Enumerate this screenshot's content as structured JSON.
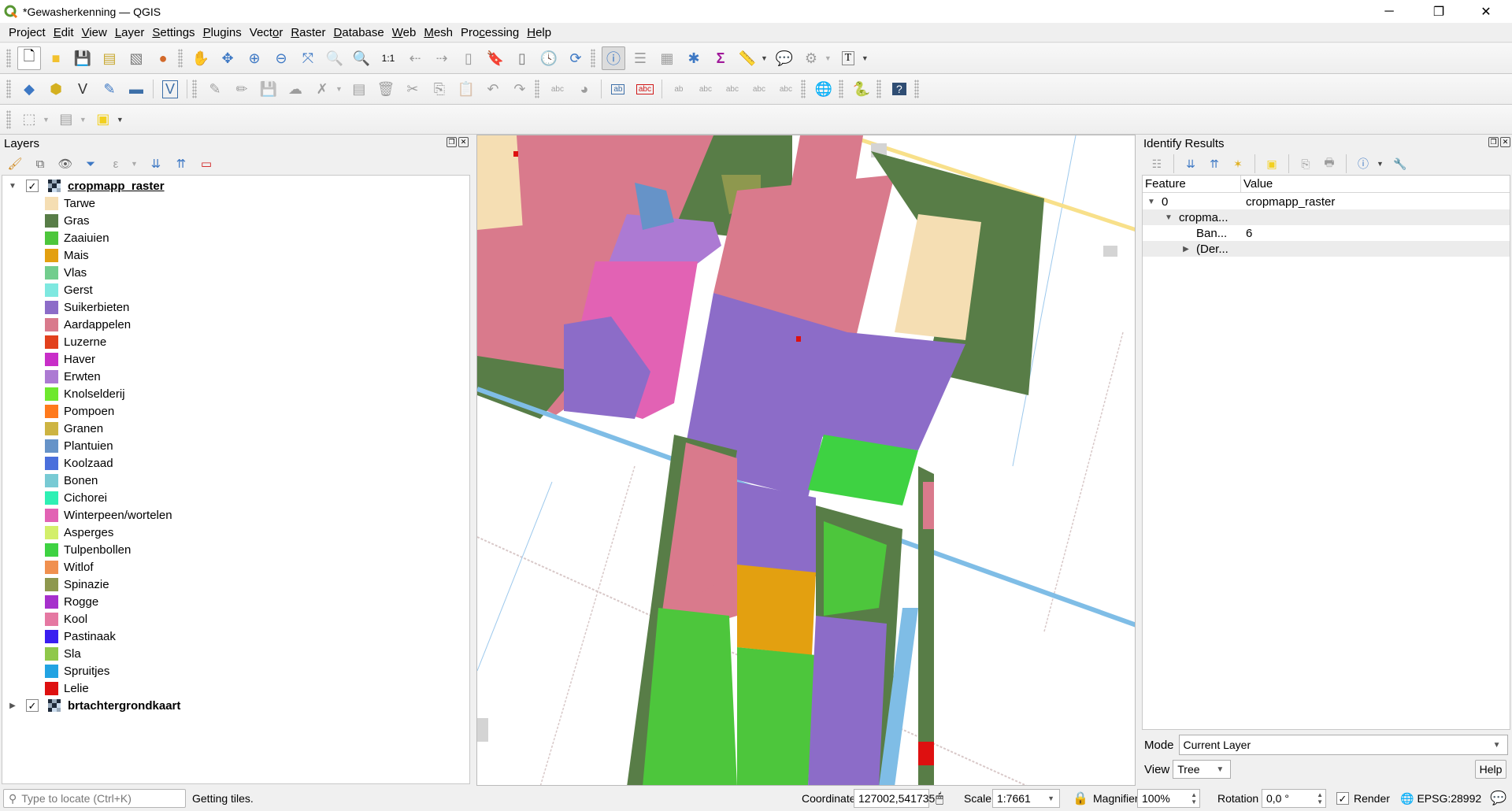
{
  "window": {
    "title": "*Gewasherkenning — QGIS",
    "app_icon": "qgis-logo-icon",
    "controls": {
      "minimize": "─",
      "maximize": "❐",
      "close": "✕"
    }
  },
  "menu": [
    {
      "label": "Project",
      "accel": "j"
    },
    {
      "label": "Edit",
      "accel": "E"
    },
    {
      "label": "View",
      "accel": "V"
    },
    {
      "label": "Layer",
      "accel": "L"
    },
    {
      "label": "Settings",
      "accel": "S"
    },
    {
      "label": "Plugins",
      "accel": "P"
    },
    {
      "label": "Vector",
      "accel": "o"
    },
    {
      "label": "Raster",
      "accel": "R"
    },
    {
      "label": "Database",
      "accel": "D"
    },
    {
      "label": "Web",
      "accel": "W"
    },
    {
      "label": "Mesh",
      "accel": "M"
    },
    {
      "label": "Processing",
      "accel": "c"
    },
    {
      "label": "Help",
      "accel": "H"
    }
  ],
  "toolbar1": {
    "icons": [
      "new-project-icon",
      "open-project-icon",
      "save-project-icon",
      "new-print-layout-icon",
      "layout-manager-icon",
      "style-manager-icon",
      "pan-icon",
      "pan-to-selection-icon",
      "zoom-in-icon",
      "zoom-out-icon",
      "zoom-full-icon",
      "zoom-to-selection-icon",
      "zoom-to-layer-icon",
      "zoom-native-icon",
      "zoom-last-icon",
      "zoom-next-icon",
      "new-map-view-icon",
      "new-bookmark-icon",
      "show-bookmarks-icon",
      "temporal-controller-icon",
      "refresh-icon",
      "identify-features-icon",
      "open-attribute-table-icon",
      "field-calculator-icon",
      "processing-toolbox-icon",
      "statistical-summary-icon",
      "measure-line-icon",
      "map-tips-icon",
      "feature-action-icon",
      "text-annotation-icon"
    ]
  },
  "toolbar2": {
    "icons": [
      "data-source-manager-icon",
      "new-geopackage-layer-icon",
      "new-shapefile-layer-icon",
      "new-temporary-scratch-layer-icon",
      "new-spatialite-layer-icon",
      "new-virtual-layer-icon",
      "current-edits-icon",
      "toggle-editing-icon",
      "save-layer-edits-icon",
      "digitize-icon",
      "vertex-tool-icon",
      "modify-attributes-icon",
      "delete-selected-icon",
      "cut-features-icon",
      "copy-features-icon",
      "paste-features-icon",
      "undo-icon",
      "redo-icon",
      "label-toolbar-icon",
      "diagram-icon",
      "layer-labeling-icon",
      "label-highlight-icon",
      "pin-label-icon",
      "show-hide-label-icon",
      "move-label-icon",
      "rotate-label-icon",
      "change-label-icon",
      "quickmapservices-icon",
      "python-console-icon",
      "help-contents-icon"
    ]
  },
  "toolbar3": {
    "icons": [
      "select-features-icon",
      "select-by-value-icon",
      "deselect-all-icon"
    ]
  },
  "layers_panel": {
    "title": "Layers",
    "toolbar_icons": [
      "open-layer-styling-icon",
      "add-group-icon",
      "manage-map-themes-icon",
      "filter-legend-icon",
      "filter-by-expression-icon",
      "expand-all-icon",
      "collapse-all-icon",
      "remove-layer-icon"
    ],
    "layers": [
      {
        "name": "cropmapp_raster",
        "checked": true,
        "expanded": true,
        "current": true,
        "legend": [
          {
            "label": "Tarwe",
            "color": "#f5deb3"
          },
          {
            "label": "Gras",
            "color": "#587d47"
          },
          {
            "label": "Zaaiuien",
            "color": "#4dc63c"
          },
          {
            "label": "Mais",
            "color": "#e3a010"
          },
          {
            "label": "Vlas",
            "color": "#72cd8d"
          },
          {
            "label": "Gerst",
            "color": "#7ee8e0"
          },
          {
            "label": "Suikerbieten",
            "color": "#8c6cc8"
          },
          {
            "label": "Aardappelen",
            "color": "#d97a8c"
          },
          {
            "label": "Luzerne",
            "color": "#e2401c"
          },
          {
            "label": "Haver",
            "color": "#c82ec8"
          },
          {
            "label": "Erwten",
            "color": "#ac7ad3"
          },
          {
            "label": "Knolselderij",
            "color": "#6ee82e"
          },
          {
            "label": "Pompoen",
            "color": "#ff7a1c"
          },
          {
            "label": "Granen",
            "color": "#cdb442"
          },
          {
            "label": "Plantuien",
            "color": "#6693c8"
          },
          {
            "label": "Koolzaad",
            "color": "#4a6fdc"
          },
          {
            "label": "Bonen",
            "color": "#78cad4"
          },
          {
            "label": "Cichorei",
            "color": "#2ef0b4"
          },
          {
            "label": "Winterpeen/wortelen",
            "color": "#e262b4"
          },
          {
            "label": "Asperges",
            "color": "#d3ef6a"
          },
          {
            "label": "Tulpenbollen",
            "color": "#3ed242"
          },
          {
            "label": "Witlof",
            "color": "#f0904f"
          },
          {
            "label": "Spinazie",
            "color": "#8e984e"
          },
          {
            "label": "Rogge",
            "color": "#a630cc"
          },
          {
            "label": "Kool",
            "color": "#e578a2"
          },
          {
            "label": "Pastinaak",
            "color": "#3a1ef0"
          },
          {
            "label": "Sla",
            "color": "#8fc84a"
          },
          {
            "label": "Spruitjes",
            "color": "#22a3e2"
          },
          {
            "label": "Lelie",
            "color": "#de1010"
          }
        ]
      },
      {
        "name": "brtachtergrondkaart",
        "checked": true,
        "expanded": false,
        "current": false
      }
    ]
  },
  "map_canvas": {
    "background_layer": "brtachtergrondkaart",
    "raster_layer": "cropmapp_raster",
    "canal_color": "#7fbde6",
    "road_color": "#f8e08a"
  },
  "identify_panel": {
    "title": "Identify Results",
    "toolbar_icons": [
      "expand-tree-icon",
      "expand-all-icon",
      "collapse-all-icon",
      "expand-new-results-icon",
      "clear-results-icon",
      "copy-feature-icon",
      "print-icon",
      "identify-mode-icon",
      "settings-wrench-icon"
    ],
    "columns": [
      "Feature",
      "Value"
    ],
    "rows": [
      {
        "feature": "0",
        "value": "cropmapp_raster",
        "level": 0,
        "arrow": "▼"
      },
      {
        "feature": "cropma...",
        "value": "",
        "level": 1,
        "arrow": "▼"
      },
      {
        "feature": "Ban...",
        "value": "6",
        "level": 2,
        "arrow": ""
      },
      {
        "feature": "(Der...",
        "value": "",
        "level": 2,
        "arrow": "▶"
      }
    ],
    "mode_label": "Mode",
    "mode_value": "Current Layer",
    "view_label": "View",
    "view_value": "Tree",
    "help_label": "Help"
  },
  "statusbar": {
    "locator_placeholder": "Type to locate (Ctrl+K)",
    "message": "Getting tiles.",
    "coordinate_label": "Coordinate",
    "coordinate_value": "127002,541735",
    "scale_label": "Scale",
    "scale_value": "1:7661",
    "magnifier_label": "Magnifier",
    "magnifier_value": "100%",
    "rotation_label": "Rotation",
    "rotation_value": "0,0 °",
    "render_label": "Render",
    "render_checked": true,
    "crs_label": "EPSG:28992"
  }
}
